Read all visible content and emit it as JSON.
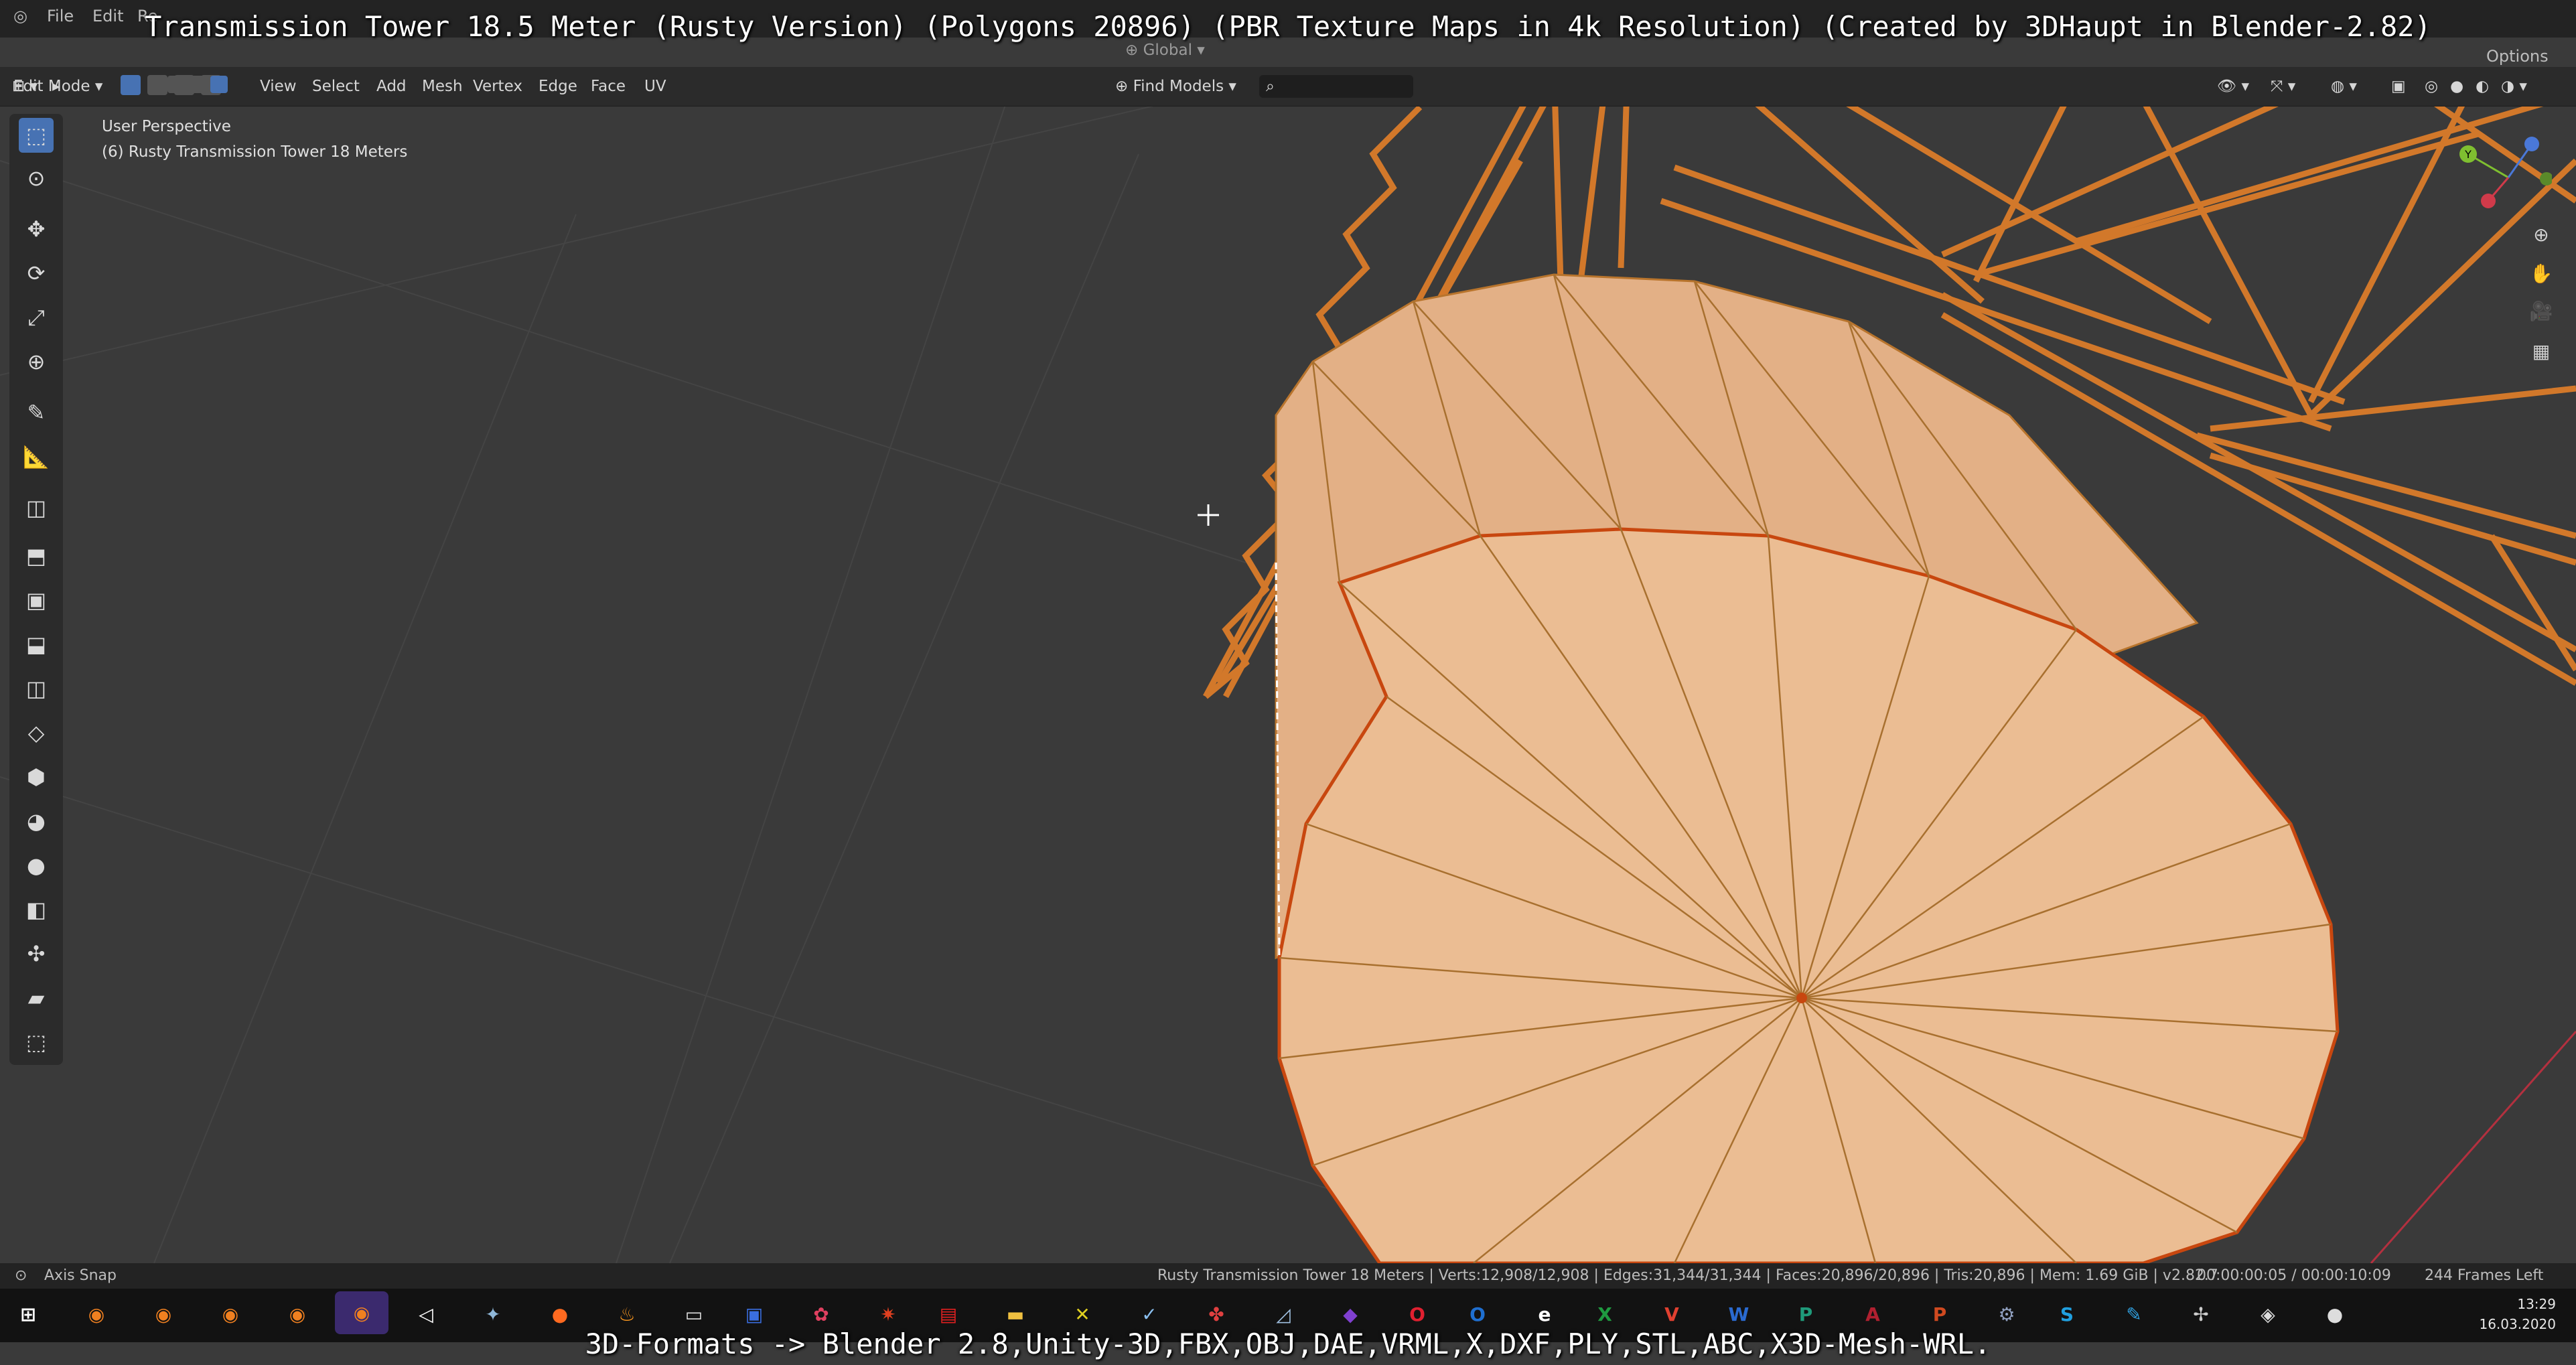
{
  "overlay": {
    "title": "Transmission Tower 18.5 Meter (Rusty Version) (Polygons 20896) (PBR Texture Maps in 4k Resolution) (Created by 3DHaupt in Blender-2.82)",
    "bottom": "3D-Formats -> Blender 2.8,Unity-3D,FBX,OBJ,DAE,VRML,X,DXF,PLY,STL,ABC,X3D-Mesh-WRL."
  },
  "topmenu": {
    "items": [
      "File",
      "Edit",
      "Re"
    ],
    "options_label": "Options"
  },
  "header": {
    "mode": "Edit Mode",
    "menus": [
      "View",
      "Select",
      "Add",
      "Mesh",
      "Vertex",
      "Edge",
      "Face",
      "UV"
    ],
    "transform_orientation": "Global",
    "find_models": "Find Models"
  },
  "viewport": {
    "perspective": "User Perspective",
    "object": "(6) Rusty Transmission Tower 18 Meters",
    "gizmo": {
      "y": "Y",
      "x": "X",
      "z": "Z"
    }
  },
  "status": {
    "left": "Axis Snap",
    "stats": "Rusty Transmission Tower 18 Meters | Verts:12,908/12,908 | Edges:31,344/31,344 | Faces:20,896/20,896 | Tris:20,896 | Mem: 1.69 GiB | v2.82.7",
    "timecode": "00:00:00:05 / 00:00:10:09",
    "frames_left": "244 Frames Left"
  },
  "clock": {
    "time": "13:29",
    "date": "16.03.2020"
  },
  "colors": {
    "accent": "#4772b3",
    "mesh": "#e6b68a",
    "edge": "#c8470f",
    "lattice": "#d2782a"
  },
  "icons": {
    "toolbar": [
      "select-box-icon",
      "cursor-icon",
      "move-icon",
      "rotate-icon",
      "scale-icon",
      "transform-icon",
      "annotate-icon",
      "measure-icon",
      "add-cube-icon",
      "extrude-icon",
      "inset-icon",
      "bevel-icon",
      "loop-cut-icon",
      "knife-icon",
      "poly-build-icon",
      "spin-icon",
      "smooth-icon",
      "edge-slide-icon",
      "shrink-icon",
      "shear-icon",
      "rip-icon"
    ]
  }
}
